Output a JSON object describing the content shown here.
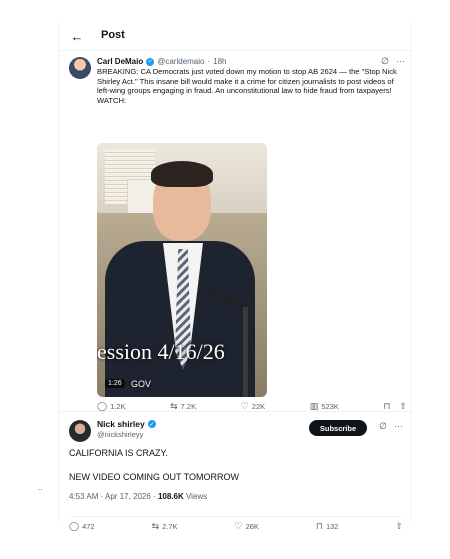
{
  "header": {
    "back_icon": "arrow-left-icon",
    "title": "Post"
  },
  "quoted_post": {
    "author_name": "Carl DeMaio",
    "author_handle": "@carldemaio",
    "separator": "·",
    "time": "18h",
    "text": "BREAKING: CA Democrats just voted down my motion to stop AB 2624 — the \"Stop Nick Shirley Act.\" This insane bill would make it a crime for citizen journalists to post videos of left-wing groups engaging in fraud. An unconstitutional law to hide fraud from taxpayers! WATCH:",
    "video": {
      "overlay_text": "ession 4/16/26",
      "gov_text": "GOV",
      "duration": "1:26"
    },
    "actions": {
      "replies": "1.2K",
      "reposts": "7.2K",
      "likes": "22K",
      "views": "523K"
    }
  },
  "main_post": {
    "author_name": "Nick shirley",
    "author_handle": "@nickshirleyy",
    "subscribe_label": "Subscribe",
    "line1": "CALIFORNIA IS CRAZY.",
    "line2": "NEW VIDEO COMING OUT TOMORROW",
    "timestamp": "4:53 AM · Apr 17, 2026 · ",
    "views_count": "108.6K",
    "views_label": " Views",
    "actions": {
      "replies": "472",
      "reposts": "2.7K",
      "likes": "26K",
      "bookmarks": "132"
    }
  },
  "left_dots": "..",
  "colors": {
    "accent": "#1d9bf0",
    "text": "#0f1419",
    "muted": "#536471",
    "button_bg": "#0f1419"
  }
}
